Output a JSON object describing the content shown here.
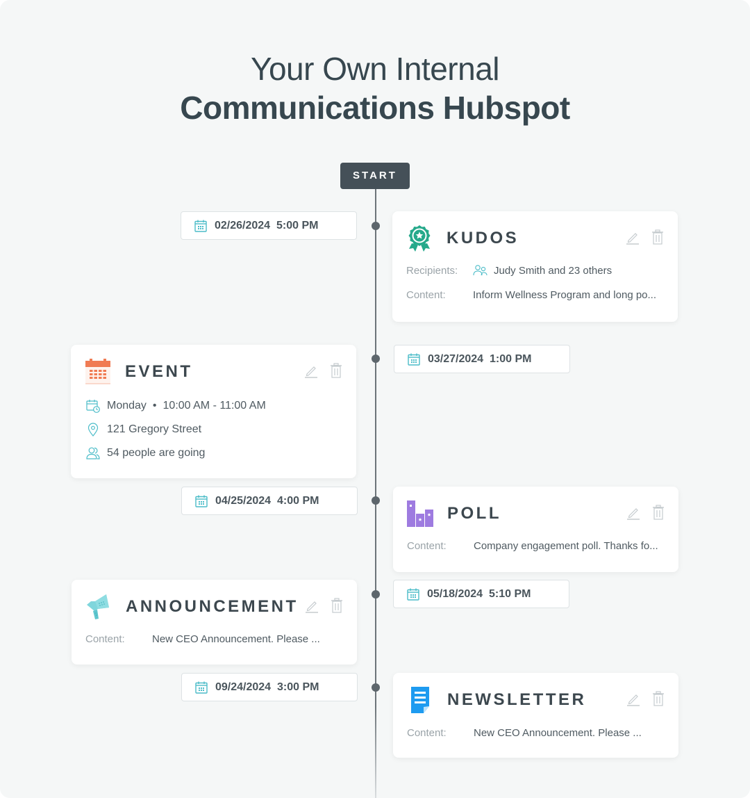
{
  "title": {
    "line1": "Your Own Internal",
    "line2": "Communications Hubspot"
  },
  "timeline": {
    "start_label": "START",
    "dates": [
      {
        "date": "02/26/2024",
        "time": "5:00 PM"
      },
      {
        "date": "03/27/2024",
        "time": "1:00 PM"
      },
      {
        "date": "04/25/2024",
        "time": "4:00 PM"
      },
      {
        "date": "05/18/2024",
        "time": "5:10 PM"
      },
      {
        "date": "09/24/2024",
        "time": "3:00 PM"
      }
    ],
    "date_labels": [
      "02/26/2024  5:00 PM",
      "03/27/2024  1:00 PM",
      "04/25/2024  4:00 PM",
      "05/18/2024  5:10 PM",
      "09/24/2024  3:00 PM"
    ]
  },
  "cards": {
    "kudos": {
      "type": "KUDOS",
      "icon": "award-ribbon-icon",
      "color": "#26a98b",
      "recipients_label": "Recipients:",
      "recipients_value": "Judy Smith and 23 others",
      "content_label": "Content:",
      "content_value": "Inform Wellness Program and long po..."
    },
    "event": {
      "type": "EVENT",
      "icon": "calendar-icon",
      "color": "#f07b53",
      "day": "Monday",
      "separator": "•",
      "time_range": "10:00 AM - 11:00 AM",
      "location": "121 Gregory Street",
      "attendees": "54 people are going"
    },
    "poll": {
      "type": "POLL",
      "icon": "bar-chart-icon",
      "color": "#9e7be0",
      "content_label": "Content:",
      "content_value": "Company engagement poll. Thanks fo..."
    },
    "announcement": {
      "type": "ANNOUNCEMENT",
      "icon": "megaphone-icon",
      "color": "#6fd0d6",
      "content_label": "Content:",
      "content_value": "New CEO Announcement. Please ..."
    },
    "newsletter": {
      "type": "NEWSLETTER",
      "icon": "document-icon",
      "color": "#1e9bf0",
      "content_label": "Content:",
      "content_value": "New CEO Announcement. Please ..."
    }
  },
  "colors": {
    "accent_teal": "#4bbcc8",
    "dark": "#37474f",
    "action_icon": "#c5cbce"
  }
}
